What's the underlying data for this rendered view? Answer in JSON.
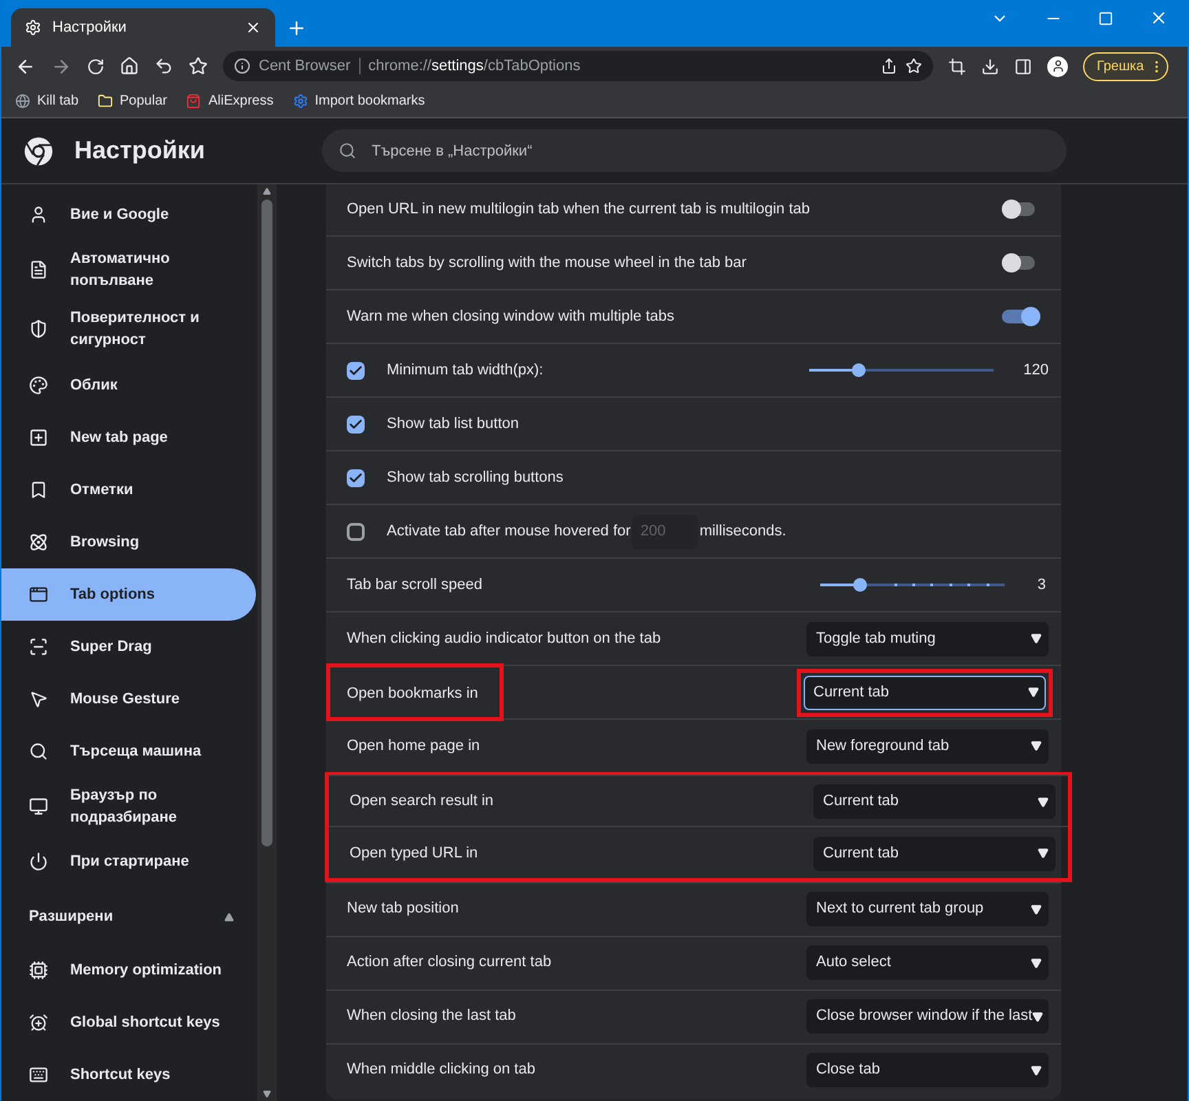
{
  "window": {
    "tab_title": "Настройки"
  },
  "toolbar": {
    "site": "Cent Browser",
    "url": "chrome://**settings**/cbTabOptions",
    "profile": "Грешка"
  },
  "bookmarks": [
    "Kill tab",
    "Popular",
    "AliExpress",
    "Import bookmarks"
  ],
  "header": {
    "title": "Настройки",
    "search": {
      "placeholder": "Търсене в „Настройки“"
    }
  },
  "sidebar": {
    "items": [
      {
        "label": "Вие и Google",
        "selected": false
      },
      {
        "label": "Автоматично попълване",
        "selected": false
      },
      {
        "label": "Поверителност и сигурност",
        "selected": false
      },
      {
        "label": "Облик",
        "selected": false
      },
      {
        "label": "New tab page",
        "selected": false
      },
      {
        "label": "Отметки",
        "selected": false
      },
      {
        "label": "Browsing",
        "selected": false
      },
      {
        "label": "Tab options",
        "selected": true
      },
      {
        "label": "Super Drag",
        "selected": false
      },
      {
        "label": "Mouse Gesture",
        "selected": false
      },
      {
        "label": "Търсеща машина",
        "selected": false
      },
      {
        "label": "Браузър по подразбиране",
        "selected": false
      },
      {
        "label": "При стартиране",
        "selected": false
      }
    ],
    "section": {
      "label": "Разширени",
      "expanded": true
    },
    "advanced_items": [
      {
        "label": "Memory optimization",
        "selected": false
      },
      {
        "label": "Global shortcut keys",
        "selected": false
      },
      {
        "label": "Shortcut keys",
        "selected": false
      }
    ]
  },
  "rows": [
    {
      "kind": "toggle",
      "label": "Open URL in new multilogin tab when the current tab is multilogin tab",
      "on": false
    },
    {
      "kind": "toggle",
      "label": "Switch tabs by scrolling with the mouse wheel in the tab bar",
      "on": false
    },
    {
      "kind": "toggle",
      "label": "Warn me when closing window with multiple tabs",
      "on": true
    },
    {
      "kind": "checkbox_slider",
      "label": "Minimum tab width(px):",
      "checked": true,
      "level": 0.27,
      "reading": "120"
    },
    {
      "kind": "checkbox",
      "label": "Show tab list button",
      "checked": true
    },
    {
      "kind": "checkbox",
      "label": "Show tab scrolling buttons",
      "checked": true
    },
    {
      "kind": "checkbox_input",
      "label": "Activate tab after mouse hovered for",
      "checked": false,
      "placeholder": "200",
      "suffix": "milliseconds."
    },
    {
      "kind": "slider",
      "label": "Tab bar scroll speed",
      "level": 0.22,
      "reading": "3"
    },
    {
      "kind": "select",
      "label": "When clicking audio indicator button on the tab",
      "value": "Toggle tab muting",
      "focused": false
    },
    {
      "kind": "select",
      "label": "Open bookmarks in",
      "value": "Current tab",
      "focused": true,
      "frame_label": true,
      "frame_value": true
    },
    {
      "kind": "select",
      "label": "Open home page in",
      "value": "New foreground tab",
      "focused": false
    },
    {
      "kind": "select",
      "label": "Open search result in",
      "value": "Current tab",
      "focused": false,
      "frame_group": true
    },
    {
      "kind": "select",
      "label": "Open typed URL in",
      "value": "Current tab",
      "focused": false,
      "frame_group": true
    },
    {
      "kind": "select",
      "label": "New tab position",
      "value": "Next to current tab group",
      "focused": false
    },
    {
      "kind": "select",
      "label": "Action after closing current tab",
      "value": "Auto select",
      "focused": false
    },
    {
      "kind": "select",
      "label": "When closing the last tab",
      "value": "Close browser window if the last",
      "focused": false
    },
    {
      "kind": "select",
      "label": "When middle clicking on tab",
      "value": "Close tab",
      "focused": false
    }
  ]
}
